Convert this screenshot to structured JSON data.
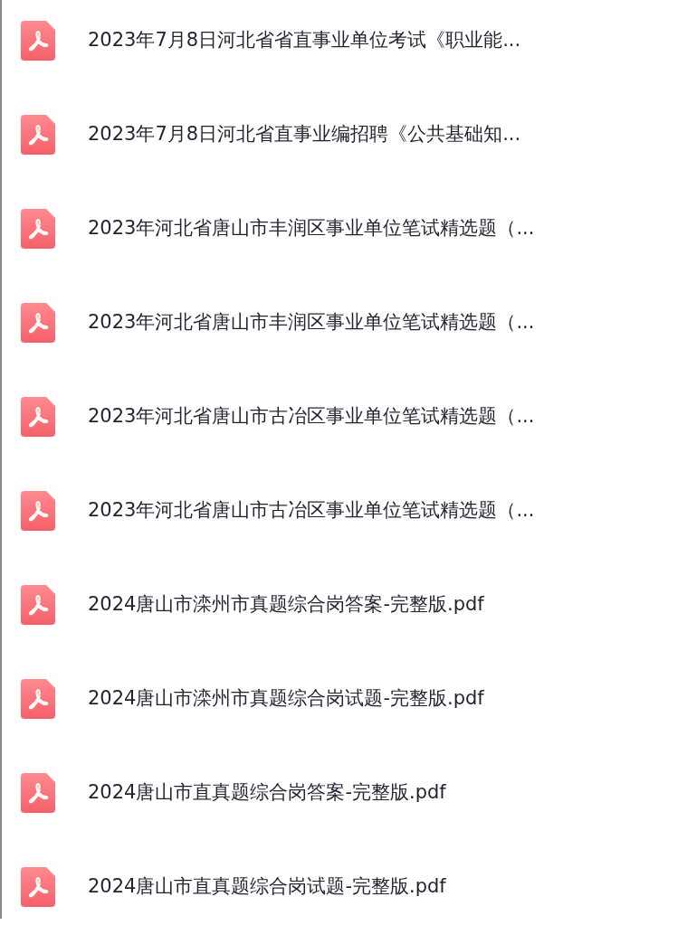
{
  "files": [
    {
      "name": "2023年7月8日河北省省直事业单位考试《职业能..."
    },
    {
      "name": "2023年7月8日河北省直事业编招聘《公共基础知..."
    },
    {
      "name": "2023年河北省唐山市丰润区事业单位笔试精选题（..."
    },
    {
      "name": "2023年河北省唐山市丰润区事业单位笔试精选题（..."
    },
    {
      "name": "2023年河北省唐山市古冶区事业单位笔试精选题（..."
    },
    {
      "name": "2023年河北省唐山市古冶区事业单位笔试精选题（..."
    },
    {
      "name": "2024唐山市滦州市真题综合岗答案-完整版.pdf"
    },
    {
      "name": "2024唐山市滦州市真题综合岗试题-完整版.pdf"
    },
    {
      "name": "2024唐山市直真题综合岗答案-完整版.pdf"
    },
    {
      "name": "2024唐山市直真题综合岗试题-完整版.pdf"
    }
  ]
}
